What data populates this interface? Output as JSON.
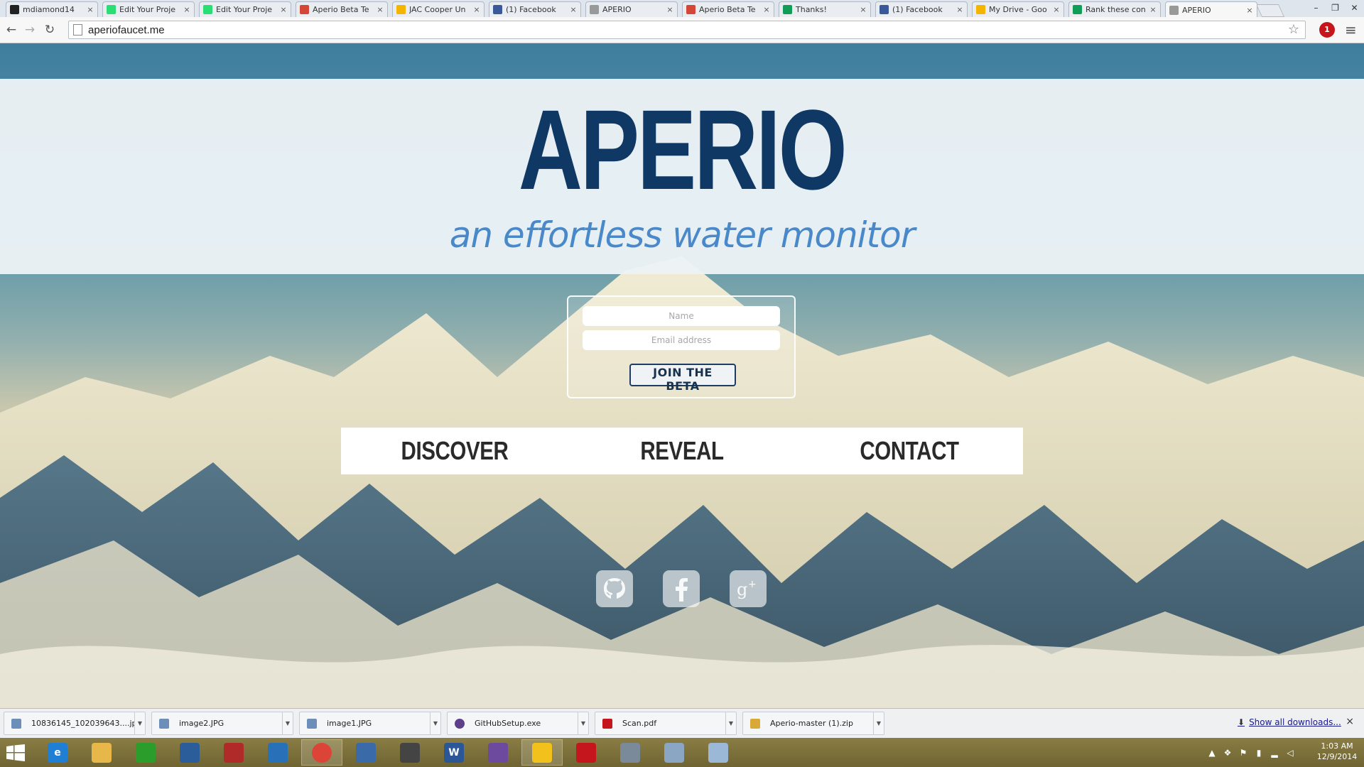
{
  "browser": {
    "tabs": [
      {
        "title": "mdiamond14",
        "icon": "github-icon",
        "color": "#222222"
      },
      {
        "title": "Edit Your Proje",
        "icon": "kickstarter-icon",
        "color": "#2bde73"
      },
      {
        "title": "Edit Your Proje",
        "icon": "kickstarter-icon",
        "color": "#2bde73"
      },
      {
        "title": "Aperio Beta Te",
        "icon": "gmail-icon",
        "color": "#d44638"
      },
      {
        "title": "JAC Cooper Un",
        "icon": "google-drive-icon",
        "color": "#f4b400"
      },
      {
        "title": "(1) Facebook",
        "icon": "facebook-icon",
        "color": "#3b5998"
      },
      {
        "title": "APERIO",
        "icon": "page-icon",
        "color": "#999999"
      },
      {
        "title": "Aperio Beta Te",
        "icon": "gmail-icon",
        "color": "#d44638"
      },
      {
        "title": "Thanks!",
        "icon": "google-sheets-icon",
        "color": "#0f9d58"
      },
      {
        "title": "(1) Facebook",
        "icon": "facebook-icon",
        "color": "#3b5998"
      },
      {
        "title": "My Drive - Goo",
        "icon": "google-drive-icon",
        "color": "#f4b400"
      },
      {
        "title": "Rank these con",
        "icon": "google-sheets-icon",
        "color": "#0f9d58"
      },
      {
        "title": "APERIO",
        "icon": "page-icon",
        "color": "#999999",
        "active": true
      }
    ],
    "close_glyph": "×",
    "url": "aperiofaucet.me",
    "extension_badge": "1"
  },
  "page": {
    "brand": "APERIO",
    "tagline": "an effortless water monitor",
    "signup": {
      "name_placeholder": "Name",
      "email_placeholder": "Email address",
      "button_label": "JOIN THE BETA"
    },
    "nav": [
      "DISCOVER",
      "REVEAL",
      "CONTACT"
    ],
    "social": [
      "github-icon",
      "facebook-icon",
      "google-plus-icon"
    ],
    "colors": {
      "brand": "#0f3864",
      "tagline": "#4a89c9",
      "button_border": "#1d3e62"
    }
  },
  "downloads": {
    "items": [
      {
        "name": "10836145_102039643....jpg",
        "icon": "image-file-icon"
      },
      {
        "name": "image2.JPG",
        "icon": "image-file-icon"
      },
      {
        "name": "image1.JPG",
        "icon": "image-file-icon"
      },
      {
        "name": "GitHubSetup.exe",
        "icon": "github-setup-icon"
      },
      {
        "name": "Scan.pdf",
        "icon": "pdf-file-icon"
      },
      {
        "name": "Aperio-master (1).zip",
        "icon": "zip-file-icon"
      }
    ],
    "show_all": "Show all downloads...",
    "close_glyph": "×"
  },
  "taskbar": {
    "apps": [
      {
        "name": "internet-explorer-icon",
        "glyph": "e",
        "color": "#1f7fd4"
      },
      {
        "name": "file-explorer-icon",
        "glyph": "",
        "color": "#e7b74a"
      },
      {
        "name": "windows-store-icon",
        "glyph": "",
        "color": "#2a9d2a"
      },
      {
        "name": "sticky-app-icon",
        "glyph": "",
        "color": "#2a5d9a"
      },
      {
        "name": "dragon-app-icon",
        "glyph": "",
        "color": "#b12a2a"
      },
      {
        "name": "remote-desktop-icon",
        "glyph": "",
        "color": "#2870b8"
      },
      {
        "name": "chrome-icon",
        "glyph": "",
        "color": "#db4437",
        "active": true
      },
      {
        "name": "notepad-pen-icon",
        "glyph": "",
        "color": "#3a6aa8"
      },
      {
        "name": "camera-app-icon",
        "glyph": "",
        "color": "#444444"
      },
      {
        "name": "word-icon",
        "glyph": "W",
        "color": "#2b5797"
      },
      {
        "name": "github-app-icon",
        "glyph": "",
        "color": "#6e4a9e"
      },
      {
        "name": "globe-app-icon",
        "glyph": "",
        "color": "#f2c11b",
        "active": true
      },
      {
        "name": "acrobat-icon",
        "glyph": "",
        "color": "#c4161c"
      },
      {
        "name": "calculator-icon",
        "glyph": "",
        "color": "#7a8a9a"
      },
      {
        "name": "eraser-app-icon",
        "glyph": "",
        "color": "#8aa6c2"
      },
      {
        "name": "paint-app-icon",
        "glyph": "",
        "color": "#9bb8d6"
      }
    ],
    "clock_time": "1:03 AM",
    "clock_date": "12/9/2014"
  }
}
